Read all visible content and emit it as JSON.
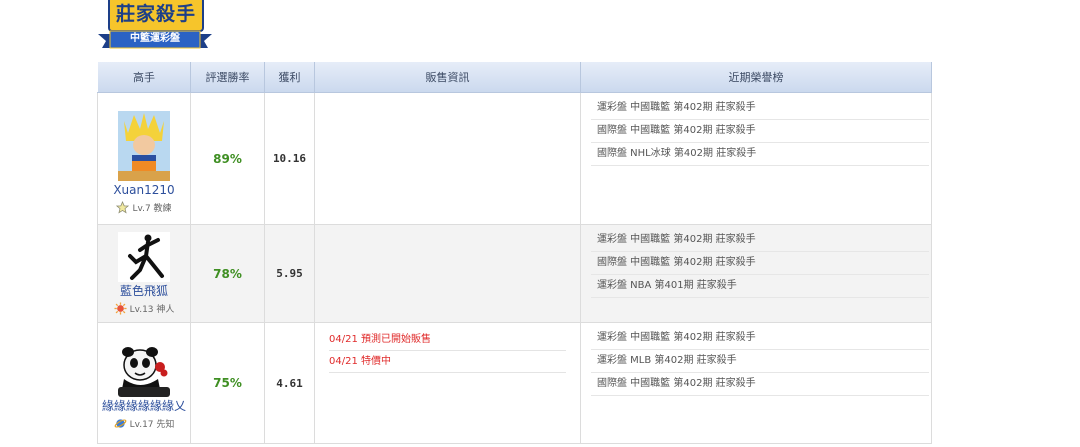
{
  "logo": {
    "title": "莊家殺手",
    "subtitle": "中籃運彩盤"
  },
  "table": {
    "headers": [
      "高手",
      "評選勝率",
      "獲利",
      "販售資訊",
      "近期榮譽榜"
    ],
    "rows": [
      {
        "name": "Xuan1210",
        "level": "Lv.7 教練",
        "badge_icon": "star-badge-icon",
        "rate": "89%",
        "profit": "10.16",
        "sales": [],
        "honors": [
          "運彩盤 中國職籃 第402期 莊家殺手",
          "國際盤 中國職籃 第402期 莊家殺手",
          "國際盤 NHL冰球 第402期 莊家殺手"
        ]
      },
      {
        "name": "藍色飛狐",
        "level": "Lv.13 神人",
        "badge_icon": "sun-badge-icon",
        "rate": "78%",
        "profit": "5.95",
        "sales": [],
        "honors": [
          "運彩盤 中國職籃 第402期 莊家殺手",
          "國際盤 中國職籃 第402期 莊家殺手",
          "運彩盤 NBA 第401期 莊家殺手"
        ]
      },
      {
        "name": "緣緣緣緣緣緣乂",
        "level": "Lv.17 先知",
        "badge_icon": "planet-badge-icon",
        "rate": "75%",
        "profit": "4.61",
        "sales": [
          "04/21 預測已開始販售",
          "04/21 特價中"
        ],
        "honors": [
          "運彩盤 中國職籃 第402期 莊家殺手",
          "運彩盤 MLB 第402期 莊家殺手",
          "國際盤 中國職籃 第402期 莊家殺手"
        ]
      }
    ]
  },
  "colors": {
    "header_bg": "#cbd9ee",
    "rate": "#3f8f23",
    "sales": "#e02b2b",
    "name": "#2d4f9c"
  }
}
